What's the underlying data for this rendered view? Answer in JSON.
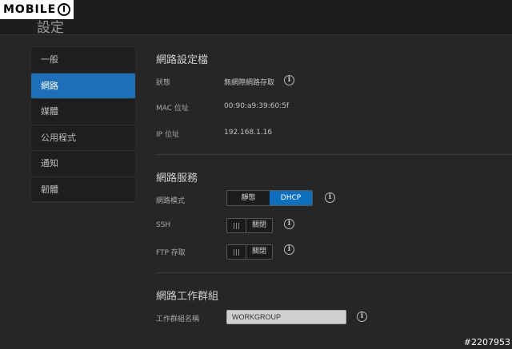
{
  "watermark": {
    "brand": "MOBILE"
  },
  "header": {
    "title": "設定"
  },
  "sidebar": {
    "items": [
      {
        "label": "一般"
      },
      {
        "label": "網路"
      },
      {
        "label": "媒體"
      },
      {
        "label": "公用程式"
      },
      {
        "label": "通知"
      },
      {
        "label": "韌體"
      }
    ],
    "active": "網路"
  },
  "network_profile": {
    "title": "網路設定檔",
    "status_label": "狀態",
    "status_value": "無網際網路存取",
    "mac_label": "MAC 位址",
    "mac_value": "00:90:a9:39:60:5f",
    "ip_label": "IP 位址",
    "ip_value": "192.168.1.16"
  },
  "network_services": {
    "title": "網路服務",
    "mode_label": "網路模式",
    "mode_options": [
      "靜態",
      "DHCP"
    ],
    "mode_selected": "DHCP",
    "ssh_label": "SSH",
    "ssh_state": "關閉",
    "ftp_label": "FTP 存取",
    "ftp_state": "關閉"
  },
  "workgroup": {
    "title": "網路工作群組",
    "name_label": "工作群組名稱",
    "name_value": "WORKGROUP"
  },
  "icons": {
    "info": "info-icon"
  },
  "colors": {
    "accent": "#1e6fb8",
    "background": "#262626"
  },
  "footer": {
    "id": "#2207953"
  }
}
